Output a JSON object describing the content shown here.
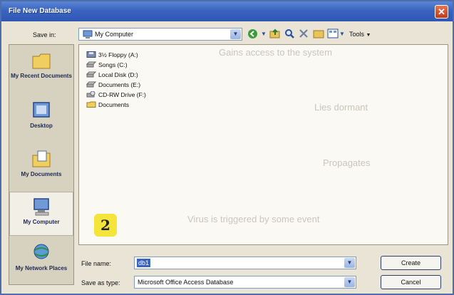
{
  "window": {
    "title": "File New Database"
  },
  "toolbar": {
    "save_in_label": "Save in:",
    "location_value": "My Computer",
    "tools_label": "Tools",
    "back_icon": "back-icon",
    "up_icon": "up-folder-icon",
    "search_icon": "search-web-icon",
    "delete_icon": "delete-icon",
    "new_folder_icon": "new-folder-icon",
    "views_icon": "views-icon"
  },
  "places": [
    {
      "label": "My Recent Documents",
      "icon": "recent-documents-icon"
    },
    {
      "label": "Desktop",
      "icon": "desktop-icon"
    },
    {
      "label": "My Documents",
      "icon": "my-documents-icon"
    },
    {
      "label": "My Computer",
      "icon": "my-computer-icon"
    },
    {
      "label": "My Network Places",
      "icon": "network-places-icon"
    }
  ],
  "files": [
    {
      "label": "3½ Floppy (A:)",
      "icon": "floppy-drive-icon"
    },
    {
      "label": "Songs (C:)",
      "icon": "hard-drive-icon"
    },
    {
      "label": "Local Disk (D:)",
      "icon": "hard-drive-icon"
    },
    {
      "label": "Documents (E:)",
      "icon": "hard-drive-icon"
    },
    {
      "label": "CD-RW Drive (F:)",
      "icon": "cd-drive-icon"
    },
    {
      "label": "Documents",
      "icon": "folder-icon"
    }
  ],
  "background_text": [
    "Gains access to the system",
    "Lies dormant",
    "Propagates",
    "Virus is triggered by some event"
  ],
  "footer": {
    "file_name_label": "File name:",
    "file_name_value": "db1",
    "save_type_label": "Save as type:",
    "save_type_value": "Microsoft Office Access Database",
    "create_label": "Create",
    "cancel_label": "Cancel"
  },
  "annotation": {
    "number": "2"
  },
  "colors": {
    "title_bar": "#3a64c0",
    "close_button": "#c43a1c",
    "badge": "#f5e43a",
    "dialog_face": "#e9e4d6"
  }
}
